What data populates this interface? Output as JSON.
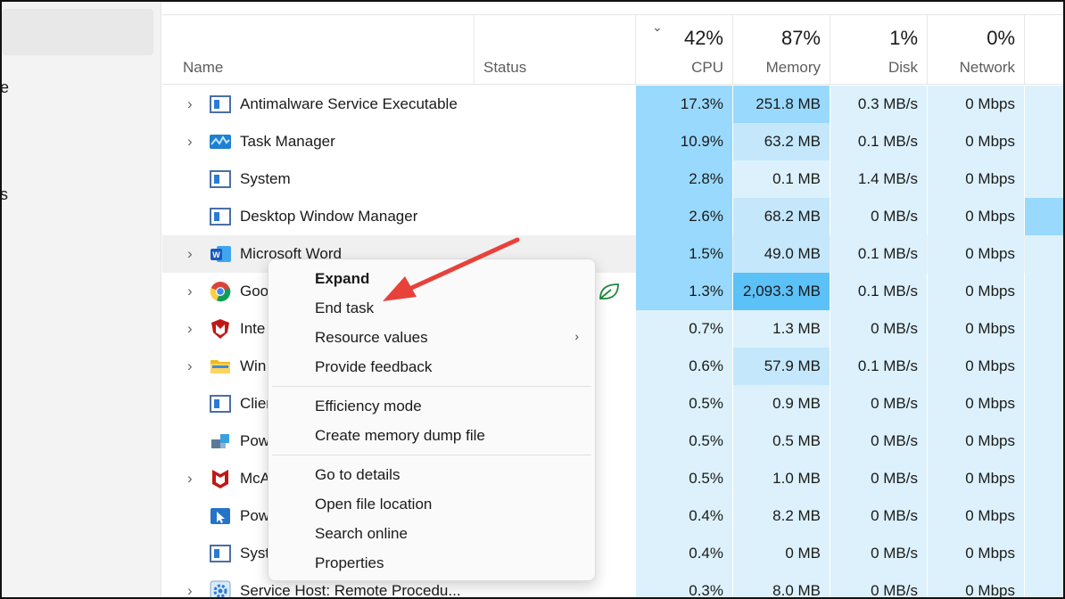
{
  "sidebar": {
    "fragments": [
      "e",
      "s"
    ]
  },
  "header": {
    "name_label": "Name",
    "status_label": "Status",
    "cpu": {
      "pct": "42%",
      "label": "CPU"
    },
    "memory": {
      "pct": "87%",
      "label": "Memory"
    },
    "disk": {
      "pct": "1%",
      "label": "Disk"
    },
    "network": {
      "pct": "0%",
      "label": "Network"
    },
    "sort_icon": "chevron-down-icon"
  },
  "rows": [
    {
      "name": "Antimalware Service Executable",
      "icon": "window-app-icon",
      "expand": true,
      "cpu": "17.3%",
      "mem": "251.8 MB",
      "disk": "0.3 MB/s",
      "net": "0 Mbps"
    },
    {
      "name": "Task Manager",
      "icon": "task-manager-icon",
      "expand": true,
      "cpu": "10.9%",
      "mem": "63.2 MB",
      "disk": "0.1 MB/s",
      "net": "0 Mbps"
    },
    {
      "name": "System",
      "icon": "window-app-icon",
      "expand": false,
      "cpu": "2.8%",
      "mem": "0.1 MB",
      "disk": "1.4 MB/s",
      "net": "0 Mbps"
    },
    {
      "name": "Desktop Window Manager",
      "icon": "window-app-icon",
      "expand": false,
      "cpu": "2.6%",
      "mem": "68.2 MB",
      "disk": "0 MB/s",
      "net": "0 Mbps"
    },
    {
      "name": "Microsoft Word",
      "icon": "word-icon",
      "expand": true,
      "cpu": "1.5%",
      "mem": "49.0 MB",
      "disk": "0.1 MB/s",
      "net": "0 Mbps"
    },
    {
      "name": "Goo",
      "icon": "chrome-icon",
      "expand": true,
      "status_icon": "efficiency-leaf-icon",
      "cpu": "1.3%",
      "mem": "2,093.3 MB",
      "disk": "0.1 MB/s",
      "net": "0 Mbps"
    },
    {
      "name": "Inte",
      "icon": "mcafee-shield-icon",
      "expand": true,
      "cpu": "0.7%",
      "mem": "1.3 MB",
      "disk": "0 MB/s",
      "net": "0 Mbps"
    },
    {
      "name": "Win",
      "icon": "folder-icon",
      "expand": true,
      "cpu": "0.6%",
      "mem": "57.9 MB",
      "disk": "0.1 MB/s",
      "net": "0 Mbps"
    },
    {
      "name": "Clier",
      "icon": "window-app-icon",
      "expand": false,
      "cpu": "0.5%",
      "mem": "0.9 MB",
      "disk": "0 MB/s",
      "net": "0 Mbps"
    },
    {
      "name": "Pow",
      "icon": "blocks-icon",
      "expand": false,
      "cpu": "0.5%",
      "mem": "0.5 MB",
      "disk": "0 MB/s",
      "net": "0 Mbps"
    },
    {
      "name": "McA",
      "icon": "mcafee-icon",
      "expand": true,
      "cpu": "0.5%",
      "mem": "1.0 MB",
      "disk": "0 MB/s",
      "net": "0 Mbps"
    },
    {
      "name": "Pow",
      "icon": "pointer-app-icon",
      "expand": false,
      "cpu": "0.4%",
      "mem": "8.2 MB",
      "disk": "0 MB/s",
      "net": "0 Mbps"
    },
    {
      "name": "Syst",
      "icon": "window-app-icon",
      "expand": false,
      "cpu": "0.4%",
      "mem": "0 MB",
      "disk": "0 MB/s",
      "net": "0 Mbps"
    },
    {
      "name": "Service Host: Remote Procedu...",
      "icon": "gear-app-icon",
      "expand": true,
      "cpu": "0.3%",
      "mem": "8.0 MB",
      "disk": "0 MB/s",
      "net": "0 Mbps"
    }
  ],
  "context_menu": {
    "items": [
      {
        "label": "Expand",
        "bold": true
      },
      {
        "label": "End task"
      },
      {
        "label": "Resource values",
        "submenu": true
      },
      {
        "label": "Provide feedback"
      },
      {
        "label": "Efficiency mode"
      },
      {
        "label": "Create memory dump file"
      },
      {
        "label": "Go to details"
      },
      {
        "label": "Open file location"
      },
      {
        "label": "Search online"
      },
      {
        "label": "Properties"
      }
    ]
  },
  "annotation": {
    "arrow": "red-arrow-icon",
    "color": "#e8413a"
  },
  "colors": {
    "heat_light": "#dcf1fc",
    "heat_mid": "#c4e7fb",
    "heat_strong": "#99d9fd",
    "heat_max": "#5cc1f7",
    "highlight_row": "#f0f0f0",
    "leaf": "#1d8a3b"
  }
}
